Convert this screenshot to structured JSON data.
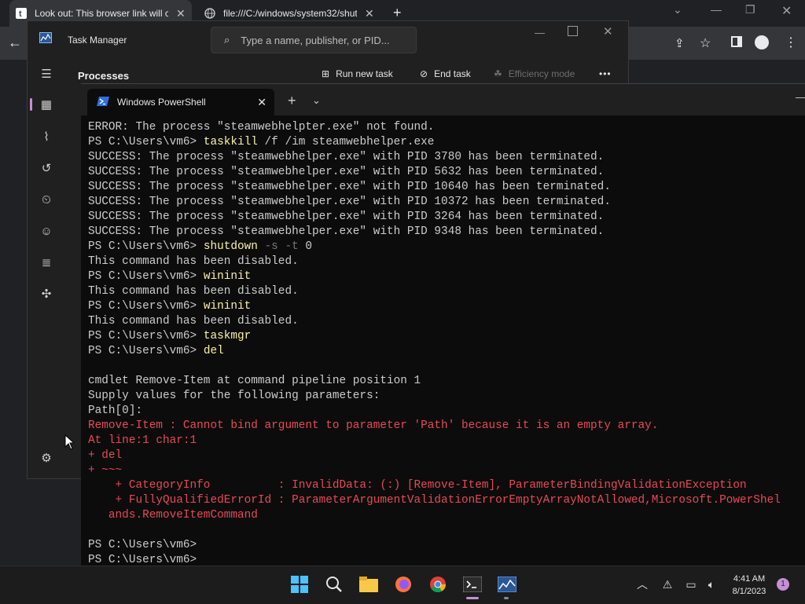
{
  "browser": {
    "tabs": [
      {
        "title": "Look out: This browser link will c",
        "favicon": "tumblr-icon"
      },
      {
        "title": "file:///C:/windows/system32/shut",
        "favicon": "globe-icon"
      }
    ],
    "new_tab": "+",
    "close": "✕"
  },
  "task_manager": {
    "title": "Task Manager",
    "search_placeholder": "Type a name, publisher, or PID...",
    "page_title": "Processes",
    "commands": {
      "run_new_task": "Run new task",
      "end_task": "End task",
      "efficiency_mode": "Efficiency mode",
      "more": "•••"
    },
    "nav_icons": [
      "hamburger-icon",
      "processes-icon",
      "performance-icon",
      "app-history-icon",
      "startup-apps-icon",
      "users-icon",
      "details-icon",
      "services-icon",
      "settings-icon"
    ]
  },
  "powershell": {
    "tab_title": "Windows PowerShell",
    "lines": [
      {
        "type": "plain",
        "text": "ERROR: The process \"steamwebhelpter.exe\" not found."
      },
      {
        "type": "cmd",
        "prompt": "PS C:\\Users\\vm6> ",
        "cmd": "taskkill",
        "args": " /f /im steamwebhelper.exe"
      },
      {
        "type": "plain",
        "text": "SUCCESS: The process \"steamwebhelper.exe\" with PID 3780 has been terminated."
      },
      {
        "type": "plain",
        "text": "SUCCESS: The process \"steamwebhelper.exe\" with PID 5632 has been terminated."
      },
      {
        "type": "plain",
        "text": "SUCCESS: The process \"steamwebhelper.exe\" with PID 10640 has been terminated."
      },
      {
        "type": "plain",
        "text": "SUCCESS: The process \"steamwebhelper.exe\" with PID 10372 has been terminated."
      },
      {
        "type": "plain",
        "text": "SUCCESS: The process \"steamwebhelper.exe\" with PID 3264 has been terminated."
      },
      {
        "type": "plain",
        "text": "SUCCESS: The process \"steamwebhelper.exe\" with PID 9348 has been terminated."
      },
      {
        "type": "cmd",
        "prompt": "PS C:\\Users\\vm6> ",
        "cmd": "shutdown",
        "params": " -s -t",
        "args": " 0"
      },
      {
        "type": "plain",
        "text": "This command has been disabled."
      },
      {
        "type": "cmd",
        "prompt": "PS C:\\Users\\vm6> ",
        "cmd": "wininit"
      },
      {
        "type": "plain",
        "text": "This command has been disabled."
      },
      {
        "type": "cmd",
        "prompt": "PS C:\\Users\\vm6> ",
        "cmd": "wininit"
      },
      {
        "type": "plain",
        "text": "This command has been disabled."
      },
      {
        "type": "cmd",
        "prompt": "PS C:\\Users\\vm6> ",
        "cmd": "taskmgr"
      },
      {
        "type": "cmd",
        "prompt": "PS C:\\Users\\vm6> ",
        "cmd": "del"
      },
      {
        "type": "plain",
        "text": ""
      },
      {
        "type": "plain",
        "text": "cmdlet Remove-Item at command pipeline position 1"
      },
      {
        "type": "plain",
        "text": "Supply values for the following parameters:"
      },
      {
        "type": "plain",
        "text": "Path[0]:"
      },
      {
        "type": "err",
        "text": "Remove-Item : Cannot bind argument to parameter 'Path' because it is an empty array."
      },
      {
        "type": "err",
        "text": "At line:1 char:1"
      },
      {
        "type": "err",
        "text": "+ del"
      },
      {
        "type": "err",
        "text": "+ ~~~"
      },
      {
        "type": "err",
        "text": "    + CategoryInfo          : InvalidData: (:) [Remove-Item], ParameterBindingValidationException"
      },
      {
        "type": "err",
        "text": "    + FullyQualifiedErrorId : ParameterArgumentValidationErrorEmptyArrayNotAllowed,Microsoft.PowerShel"
      },
      {
        "type": "err",
        "text": "   ands.RemoveItemCommand"
      },
      {
        "type": "plain",
        "text": ""
      },
      {
        "type": "plain",
        "text": "PS C:\\Users\\vm6>"
      },
      {
        "type": "plain",
        "text": "PS C:\\Users\\vm6>"
      }
    ]
  },
  "taskbar": {
    "apps": [
      "windows-start-icon",
      "search-icon",
      "file-explorer-icon",
      "firefox-icon",
      "chrome-icon",
      "terminal-icon",
      "task-manager-icon"
    ],
    "time": "4:41 AM",
    "date": "8/1/2023",
    "notification_count": "1"
  },
  "colors": {
    "console_bg": "#0c0c0c",
    "command": "#f9f1a5",
    "error": "#e74856",
    "text": "#cccccc"
  }
}
